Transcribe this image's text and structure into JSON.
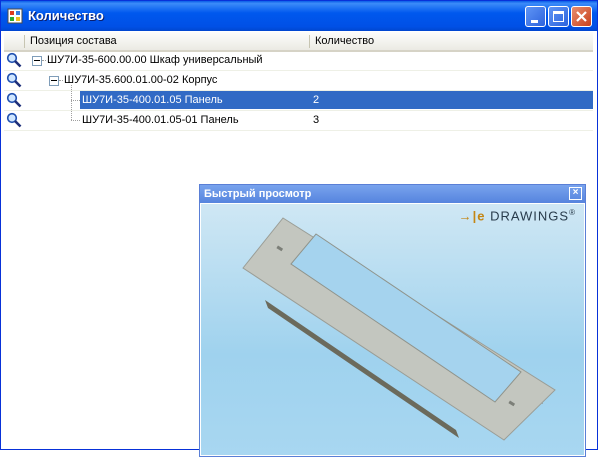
{
  "window": {
    "title": "Количество",
    "colors": {
      "titlebar": "#0058ee",
      "selection": "#316ac5"
    }
  },
  "columns": {
    "position": "Позиция состава",
    "quantity": "Количество"
  },
  "rows": [
    {
      "label": "ШУ7И-35-600.00.00 Шкаф универсальный",
      "qty": ""
    },
    {
      "label": "ШУ7И-35.600.01.00-02 Корпус",
      "qty": ""
    },
    {
      "label": "ШУ7И-35-400.01.05 Панель",
      "qty": "2"
    },
    {
      "label": "ШУ7И-35-400.01.05-01 Панель",
      "qty": "3"
    }
  ],
  "preview": {
    "title": "Быстрый просмотр",
    "logo": "DRAWINGS",
    "logo_prefix": "→|e",
    "logo_suffix": "®"
  },
  "icons": [
    "app-icon",
    "magnifier-icon",
    "minimize-icon",
    "maximize-icon",
    "close-icon"
  ]
}
